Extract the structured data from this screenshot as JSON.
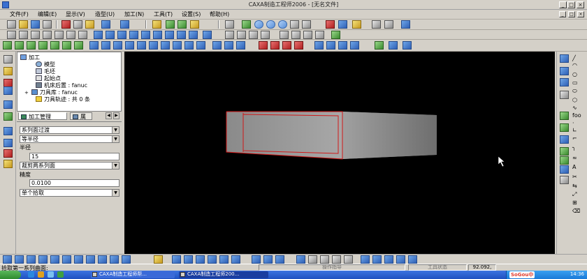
{
  "window": {
    "title": "CAXA制造工程师2006 - [无名文件]"
  },
  "menu": {
    "items": [
      "文件(F)",
      "编辑(E)",
      "显示(V)",
      "造型(U)",
      "加工(N)",
      "工具(T)",
      "设置(S)",
      "帮助(H)"
    ]
  },
  "tree": {
    "root": "加工",
    "items": [
      "模型",
      "毛坯",
      "起始点",
      "机床后置 : fanuc",
      "刀具库 : fanuc",
      "刀具轨迹 : 共 0 条"
    ]
  },
  "tabs": {
    "active": "加工管理",
    "second": "属"
  },
  "props": {
    "select1": "系列面过渡",
    "select2": "等半径",
    "radius_label": "半径",
    "radius_value": "15",
    "select3": "裁剪两系列面",
    "precision_label": "精度",
    "precision_value": "0.0100",
    "select4": "单个拾取"
  },
  "status": {
    "prompt": "拾取第一系列曲面:",
    "cmd": "操作指导",
    "tool_state": "工具状态",
    "coords": "92.092,"
  },
  "taskbar": {
    "task1": "CAXA制造工程师帮...",
    "task2": "CAXA制造工程师200...",
    "ime": "SoGou中",
    "clock": "14:36"
  },
  "right_column": {
    "label": "foo"
  },
  "colors": {
    "viewport_bg": "#000000",
    "edge_highlight": "#d01818",
    "model_face": "#9a9a9a"
  }
}
